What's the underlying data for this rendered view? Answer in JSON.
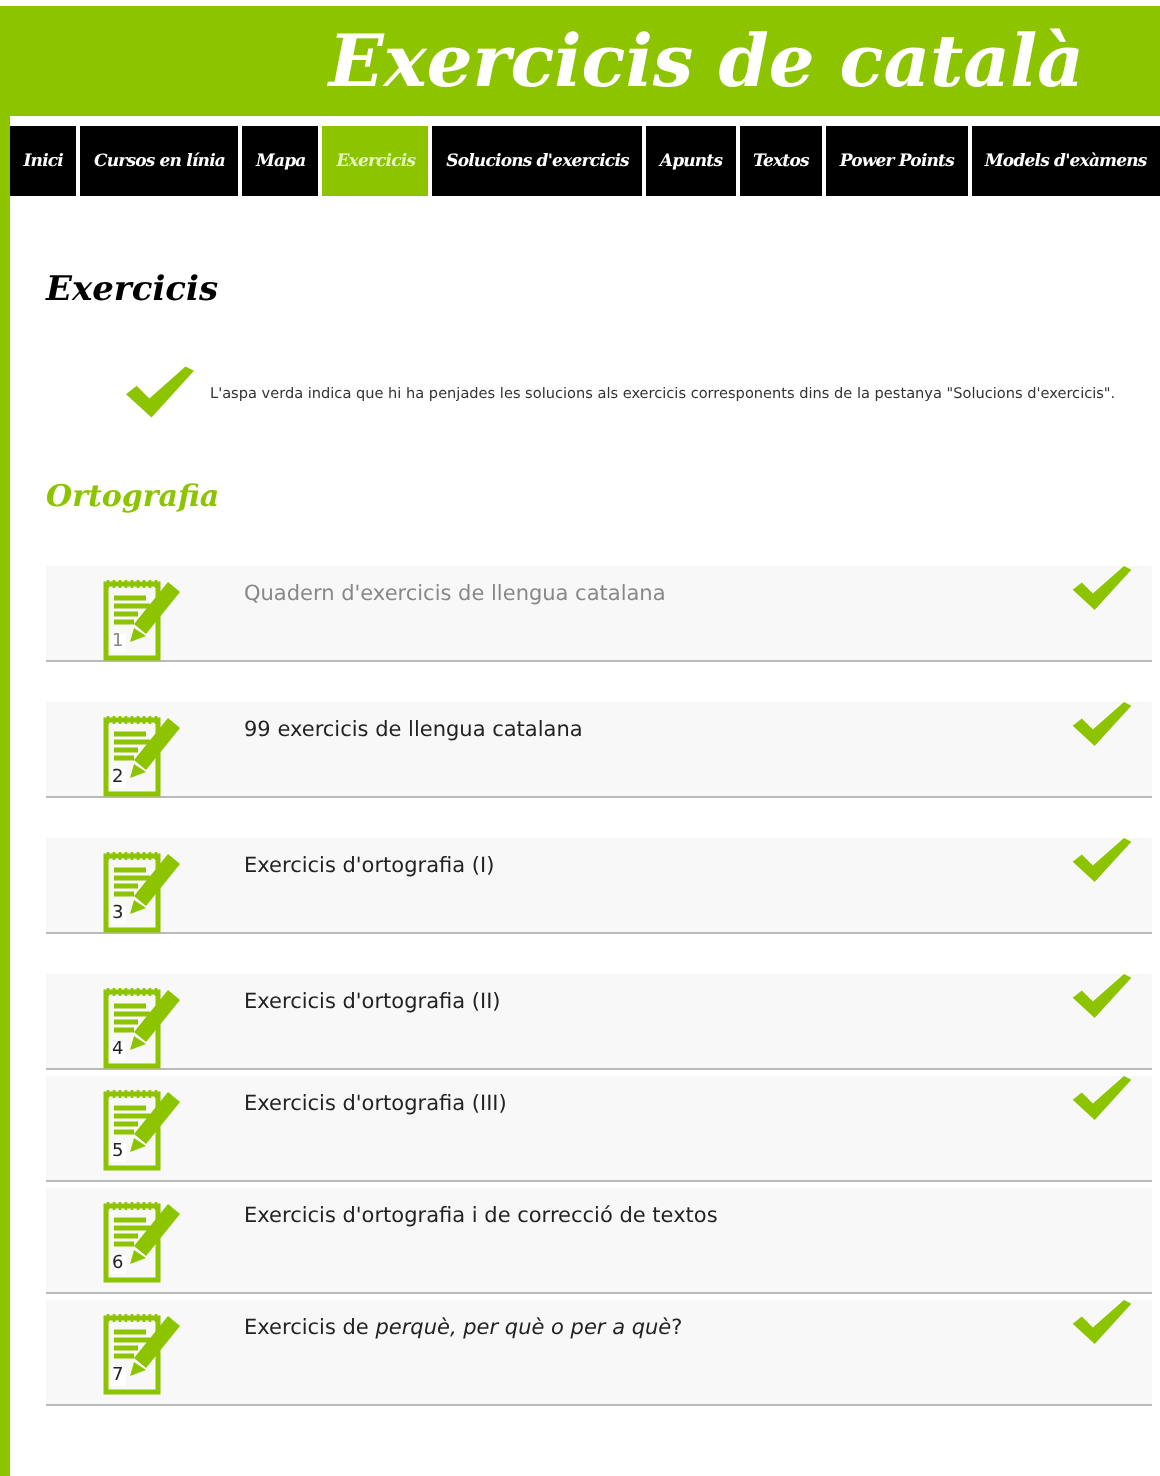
{
  "header": {
    "title": "Exercicis de català"
  },
  "nav": [
    {
      "label": "Inici",
      "selected": false
    },
    {
      "label": "Cursos en línia",
      "selected": false
    },
    {
      "label": "Mapa",
      "selected": false
    },
    {
      "label": "Exercicis",
      "selected": true
    },
    {
      "label": "Solucions d'exercicis",
      "selected": false
    },
    {
      "label": "Apunts",
      "selected": false
    },
    {
      "label": "Textos",
      "selected": false
    },
    {
      "label": "Power Points",
      "selected": false
    },
    {
      "label": "Models d'exàmens",
      "selected": false
    }
  ],
  "page_title": "Exercicis",
  "legend": "L'aspa verda indica que hi ha penjades les solucions als exercicis corresponents dins de la pestanya \"Solucions d'exercicis\".",
  "section": "Ortografia",
  "items": [
    {
      "number": "1",
      "title": "Quadern d'exercicis de llengua catalana",
      "visited": true,
      "solved": true
    },
    {
      "number": "2",
      "title": "99 exercicis de llengua catalana",
      "visited": false,
      "solved": true
    },
    {
      "number": "3",
      "title": "Exercicis d'ortografia (I)",
      "visited": false,
      "solved": true
    },
    {
      "number": "4",
      "title": "Exercicis d'ortografia (II)",
      "visited": false,
      "solved": true
    },
    {
      "number": "5",
      "title": "Exercicis d'ortografia (III)",
      "visited": false,
      "solved": true
    },
    {
      "number": "6",
      "title": "Exercicis d'ortografia i de correcció de textos",
      "visited": false,
      "solved": false
    },
    {
      "number": "7",
      "title": "Exercicis de *perquè, per què o per a què*?",
      "visited": false,
      "solved": true
    }
  ]
}
